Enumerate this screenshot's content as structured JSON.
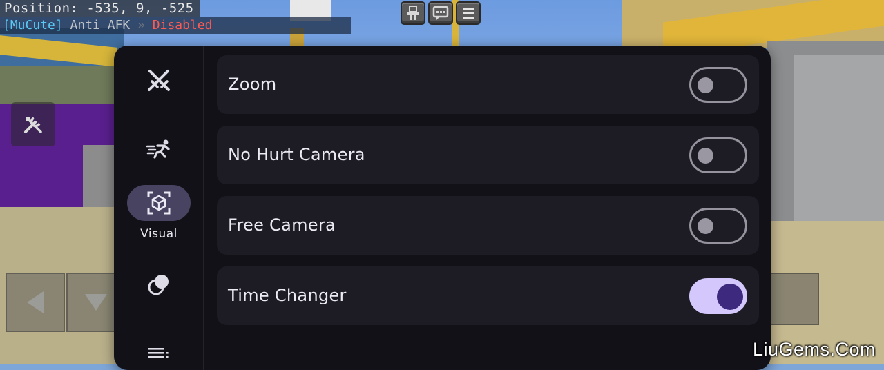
{
  "hud": {
    "position_text": "Position: -535, 9, -525",
    "afk_tag": "[MuCute]",
    "afk_module": "Anti AFK",
    "afk_separator": "»",
    "afk_status": "Disabled"
  },
  "top_buttons": [
    {
      "icon": "emote-icon"
    },
    {
      "icon": "chat-icon"
    },
    {
      "icon": "menu-icon"
    }
  ],
  "nav": {
    "items": [
      {
        "icon": "crossed-swords-icon",
        "label": ""
      },
      {
        "icon": "running-man-icon",
        "label": ""
      },
      {
        "icon": "cube-focus-icon",
        "label": "Visual",
        "active": true
      },
      {
        "icon": "circles-icon",
        "label": ""
      }
    ],
    "menu_icon": "list-icon"
  },
  "modules": [
    {
      "label": "Zoom",
      "enabled": false
    },
    {
      "label": "No Hurt Camera",
      "enabled": false
    },
    {
      "label": "Free Camera",
      "enabled": false
    },
    {
      "label": "Time Changer",
      "enabled": true
    }
  ],
  "colors": {
    "panel": "#121118",
    "row": "#1d1c24",
    "active_nav": "#474360",
    "toggle_on_track": "#d3c7fb",
    "toggle_on_knob": "#3d2a7e",
    "afk_disabled": "#ff5a52"
  },
  "watermark": "LiuGems.Com"
}
